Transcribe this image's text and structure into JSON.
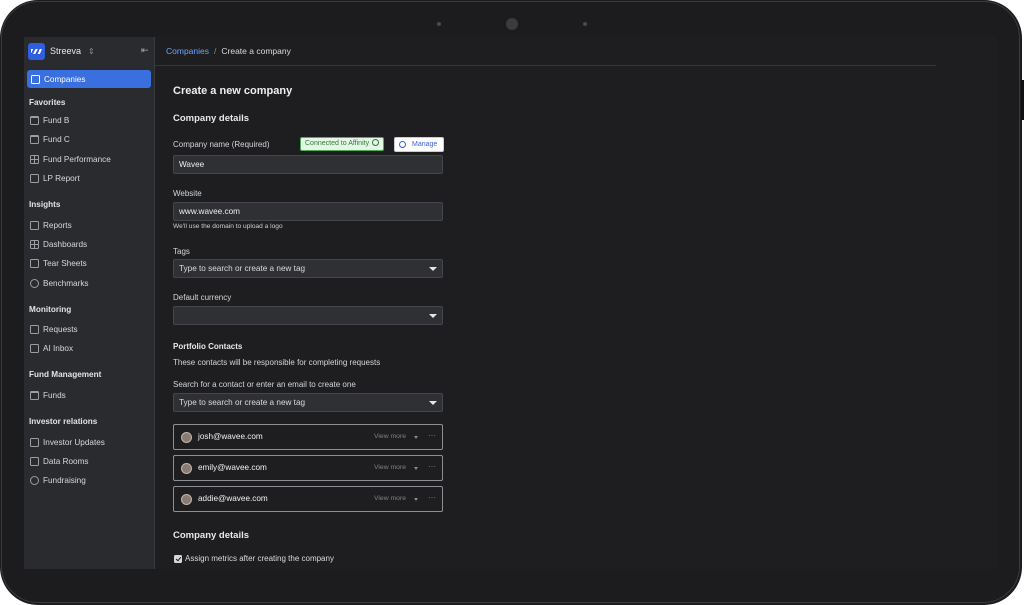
{
  "app": {
    "name": "Streeva"
  },
  "sidebar": {
    "active": "Companies",
    "sections": [
      {
        "title": "Favorites",
        "items": [
          "Fund B",
          "Fund C",
          "Fund Performance",
          "LP Report"
        ]
      },
      {
        "title": "Insights",
        "items": [
          "Reports",
          "Dashboards",
          "Tear Sheets",
          "Benchmarks"
        ]
      },
      {
        "title": "Monitoring",
        "items": [
          "Requests",
          "AI Inbox"
        ]
      },
      {
        "title": "Fund Management",
        "items": [
          "Funds"
        ]
      },
      {
        "title": "Investor relations",
        "items": [
          "Investor Updates",
          "Data Rooms",
          "Fundraising"
        ]
      }
    ]
  },
  "breadcrumb": {
    "parent": "Companies",
    "separator": "/",
    "current": "Create a company"
  },
  "form": {
    "title": "Create a new company",
    "company_details_heading": "Company details",
    "company_name": {
      "label": "Company name (Required)",
      "value": "Wavee"
    },
    "affinity": {
      "badge": "Connected to Affinity",
      "manage": "Manage"
    },
    "website": {
      "label": "Website",
      "value": "www.wavee.com",
      "help": "We'll use the domain to upload a logo"
    },
    "tags": {
      "label": "Tags",
      "placeholder": "Type to search or create a new tag"
    },
    "currency": {
      "label": "Default currency",
      "value": ""
    },
    "portfolio": {
      "heading": "Portfolio Contacts",
      "description": "These contacts will be responsible for completing requests",
      "search_label": "Search for a contact or enter an email to create one",
      "search_placeholder": "Type to search or create a new tag",
      "contacts": [
        {
          "email": "josh@wavee.com",
          "view_more": "View more",
          "menu": "···"
        },
        {
          "email": "emily@wavee.com",
          "view_more": "View more",
          "menu": "···"
        },
        {
          "email": "addie@wavee.com",
          "view_more": "View more",
          "menu": "···"
        }
      ]
    },
    "company_details_heading_2": "Company details",
    "assign_metrics": {
      "label": "Assign metrics after creating the company",
      "checked": true
    }
  }
}
